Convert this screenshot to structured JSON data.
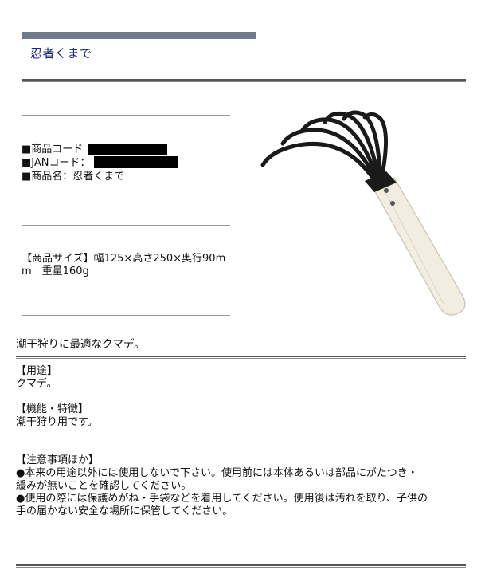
{
  "title": "忍者くまで",
  "info": {
    "code_label": "■商品コード",
    "jan_label": "■JANコード：",
    "name_label": "■商品名：忍者くまで"
  },
  "size": {
    "line1": "【商品サイズ】幅125×高さ250×奥行90m",
    "line2": "m　重量160g"
  },
  "tagline": "潮干狩りに最適なクマデ。",
  "details": {
    "usage_heading": "【用途】",
    "usage_text": "クマデ。",
    "feature_heading": "【機能・特徴】",
    "feature_text": "潮干狩り用です。",
    "caution_heading": "【注意事項ほか】",
    "caution_1a": "●本来の用途以外には使用しないで下さい。使用前には本体あるいは部品にがたつき・",
    "caution_1b": "緩みが無いことを確認してください。",
    "caution_2a": "●使用の際には保護めがね・手袋などを着用してください。使用後は汚れを取り、子供の",
    "caution_2b": "手の届かない安全な場所に保管してください。"
  },
  "colors": {
    "title_bar": "#6e7b8c",
    "title_text": "#1a2a7a",
    "handle": "#f1ede0",
    "tines": "#1a1a1a"
  }
}
